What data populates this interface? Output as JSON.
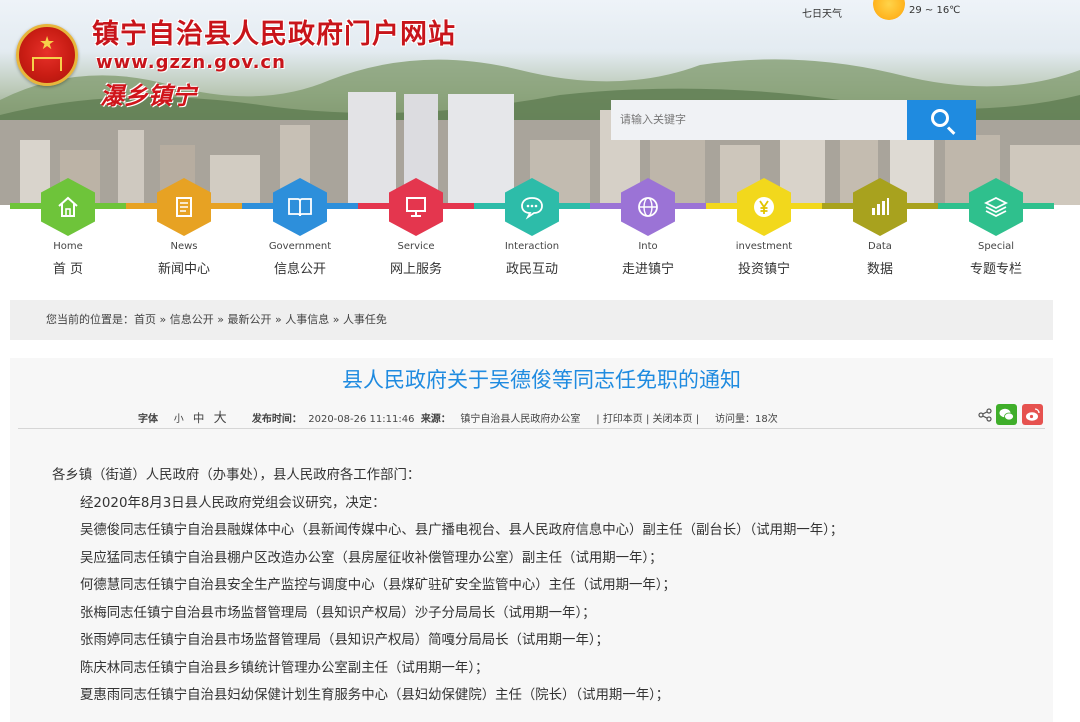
{
  "header": {
    "site_title": "镇宁自治县人民政府门户网站",
    "site_url": "www.gzzn.gov.cn",
    "slogan": "瀑乡镇宁",
    "weather_label": "七日天气",
    "temperature": "29 ~ 16℃",
    "search_placeholder": "请输入关键字"
  },
  "nav": {
    "items": [
      {
        "en": "Home",
        "cn": "首 页",
        "icon": "home-icon",
        "color": "#6ec43a"
      },
      {
        "en": "News",
        "cn": "新闻中心",
        "icon": "news-icon",
        "color": "#e7a223"
      },
      {
        "en": "Government",
        "cn": "信息公开",
        "icon": "book-icon",
        "color": "#2d8fdb"
      },
      {
        "en": "Service",
        "cn": "网上服务",
        "icon": "monitor-icon",
        "color": "#e4364e"
      },
      {
        "en": "Interaction",
        "cn": "政民互动",
        "icon": "chat-icon",
        "color": "#2dbca9"
      },
      {
        "en": "Into",
        "cn": "走进镇宁",
        "icon": "globe-icon",
        "color": "#9b73d6"
      },
      {
        "en": "investment",
        "cn": "投资镇宁",
        "icon": "yen-icon",
        "color": "#f2d81c"
      },
      {
        "en": "Data",
        "cn": "数据",
        "icon": "chart-icon",
        "color": "#a8a21e"
      },
      {
        "en": "Special",
        "cn": "专题专栏",
        "icon": "layers-icon",
        "color": "#2fc08d"
      }
    ]
  },
  "breadcrumb": {
    "prefix": "您当前的位置是：",
    "items": [
      "首页",
      "信息公开",
      "最新公开",
      "人事信息",
      "人事任免"
    ]
  },
  "article": {
    "title": "县人民政府关于吴德俊等同志任免职的通知",
    "font_label": "字体",
    "font_small": "小",
    "font_medium": "中",
    "font_large": "大",
    "publish_label": "发布时间：",
    "publish_time": "2020-08-26 11:11:46",
    "source_label": "来源：",
    "source": "镇宁自治县人民政府办公室",
    "print_link": "打印本页",
    "close_link": "关闭本页",
    "views_label": "访问量：",
    "views": "18次",
    "paragraphs": [
      "各乡镇（街道）人民政府（办事处），县人民政府各工作部门：",
      "经2020年8月3日县人民政府党组会议研究，决定：",
      "吴德俊同志任镇宁自治县融媒体中心（县新闻传媒中心、县广播电视台、县人民政府信息中心）副主任（副台长）（试用期一年）；",
      "吴应猛同志任镇宁自治县棚户区改造办公室（县房屋征收补偿管理办公室）副主任（试用期一年）；",
      "何德慧同志任镇宁自治县安全生产监控与调度中心（县煤矿驻矿安全监管中心）主任（试用期一年）；",
      "张梅同志任镇宁自治县市场监督管理局（县知识产权局）沙子分局局长（试用期一年）；",
      "张雨婷同志任镇宁自治县市场监督管理局（县知识产权局）简嘎分局局长（试用期一年）；",
      "陈庆林同志任镇宁自治县乡镇统计管理办公室副主任（试用期一年）；",
      "夏惠雨同志任镇宁自治县妇幼保健计划生育服务中心（县妇幼保健院）主任（院长）（试用期一年）；"
    ]
  }
}
